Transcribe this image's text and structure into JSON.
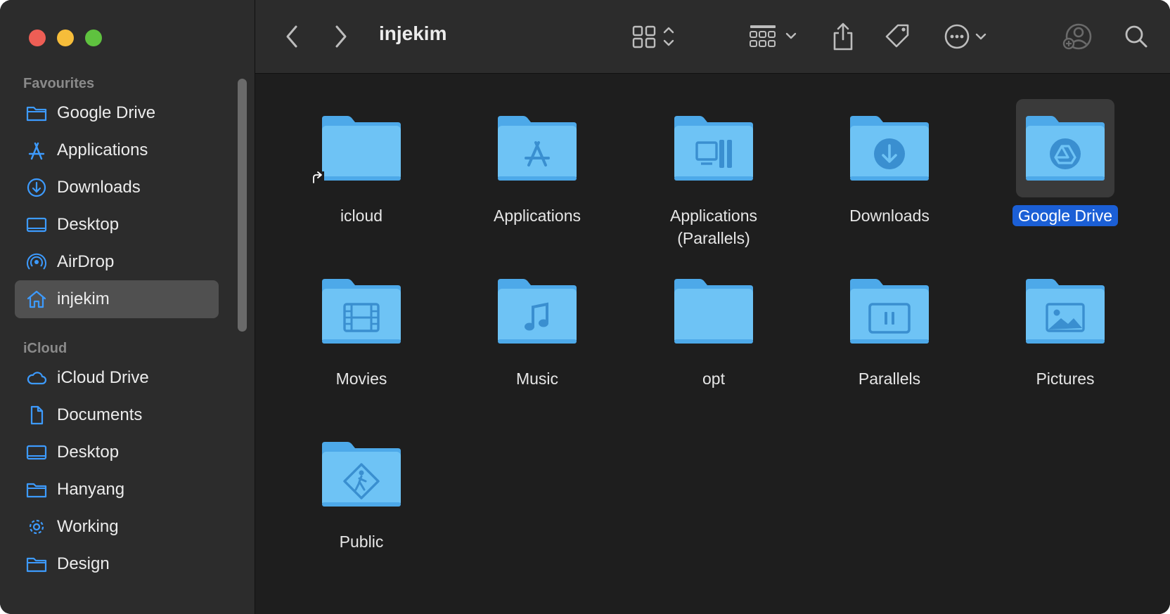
{
  "window": {
    "title": "injekim"
  },
  "sidebar": {
    "favourites_heading": "Favourites",
    "favourites": [
      {
        "label": "Google Drive",
        "icon": "folder-icon"
      },
      {
        "label": "Applications",
        "icon": "applications-icon"
      },
      {
        "label": "Downloads",
        "icon": "download-icon"
      },
      {
        "label": "Desktop",
        "icon": "desktop-icon"
      },
      {
        "label": "AirDrop",
        "icon": "airdrop-icon"
      },
      {
        "label": "injekim",
        "icon": "home-icon",
        "selected": true
      }
    ],
    "icloud_heading": "iCloud",
    "icloud": [
      {
        "label": "iCloud Drive",
        "icon": "cloud-icon"
      },
      {
        "label": "Documents",
        "icon": "document-icon"
      },
      {
        "label": "Desktop",
        "icon": "desktop-icon"
      },
      {
        "label": "Hanyang",
        "icon": "folder-icon"
      },
      {
        "label": "Working",
        "icon": "gear-icon"
      },
      {
        "label": "Design",
        "icon": "folder-icon"
      }
    ]
  },
  "toolbar": {
    "back": "back-icon",
    "forward": "forward-icon",
    "view_mode": "grid-view-icon",
    "group": "group-icon",
    "share": "share-icon",
    "tag": "tag-icon",
    "more": "more-icon",
    "shared_user": "shared-user-icon",
    "search": "search-icon"
  },
  "items": [
    {
      "label": "icloud",
      "glyph": "none",
      "alias": true
    },
    {
      "label": "Applications",
      "glyph": "applications"
    },
    {
      "label": "Applications\n(Parallels)",
      "glyph": "parallels-apps"
    },
    {
      "label": "Downloads",
      "glyph": "download"
    },
    {
      "label": "Google Drive",
      "glyph": "gdrive",
      "selected": true
    },
    {
      "label": "Movies",
      "glyph": "film"
    },
    {
      "label": "Music",
      "glyph": "music"
    },
    {
      "label": "opt",
      "glyph": "none"
    },
    {
      "label": "Parallels",
      "glyph": "pause"
    },
    {
      "label": "Pictures",
      "glyph": "picture"
    },
    {
      "label": "Public",
      "glyph": "public"
    }
  ],
  "colors": {
    "accent": "#1b5fd6",
    "folder_body": "#6ec3f5",
    "folder_tab": "#4da9e9",
    "sidebar_icon": "#3d9bff"
  }
}
